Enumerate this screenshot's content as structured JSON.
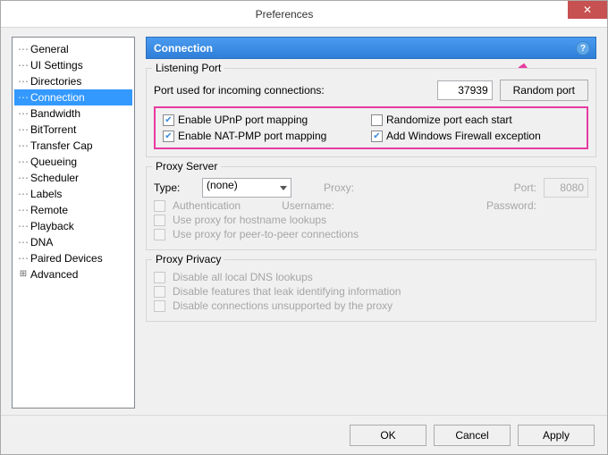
{
  "window": {
    "title": "Preferences",
    "close_glyph": "✕"
  },
  "tree": {
    "items": [
      "General",
      "UI Settings",
      "Directories",
      "Connection",
      "Bandwidth",
      "BitTorrent",
      "Transfer Cap",
      "Queueing",
      "Scheduler",
      "Labels",
      "Remote",
      "Playback",
      "DNA",
      "Paired Devices",
      "Advanced"
    ],
    "selected_index": 3,
    "expandable_index": 14
  },
  "panel": {
    "title": "Connection",
    "help_glyph": "?"
  },
  "listening_port": {
    "group_title": "Listening Port",
    "port_label": "Port used for incoming connections:",
    "port_value": "37939",
    "random_button": "Random port",
    "checkboxes": {
      "upnp": {
        "label": "Enable UPnP port mapping",
        "checked": true
      },
      "natpmp": {
        "label": "Enable NAT-PMP port mapping",
        "checked": true
      },
      "randomize": {
        "label": "Randomize port each start",
        "checked": false
      },
      "firewall": {
        "label": "Add Windows Firewall exception",
        "checked": true
      }
    }
  },
  "proxy_server": {
    "group_title": "Proxy Server",
    "type_label": "Type:",
    "type_value": "(none)",
    "proxy_label": "Proxy:",
    "port_label": "Port:",
    "port_value": "8080",
    "auth_label": "Authentication",
    "user_label": "Username:",
    "pass_label": "Password:",
    "hostname_label": "Use proxy for hostname lookups",
    "p2p_label": "Use proxy for peer-to-peer connections"
  },
  "proxy_privacy": {
    "group_title": "Proxy Privacy",
    "dns_label": "Disable all local DNS lookups",
    "leak_label": "Disable features that leak identifying information",
    "unsupported_label": "Disable connections unsupported by the proxy"
  },
  "footer": {
    "ok": "OK",
    "cancel": "Cancel",
    "apply": "Apply"
  }
}
